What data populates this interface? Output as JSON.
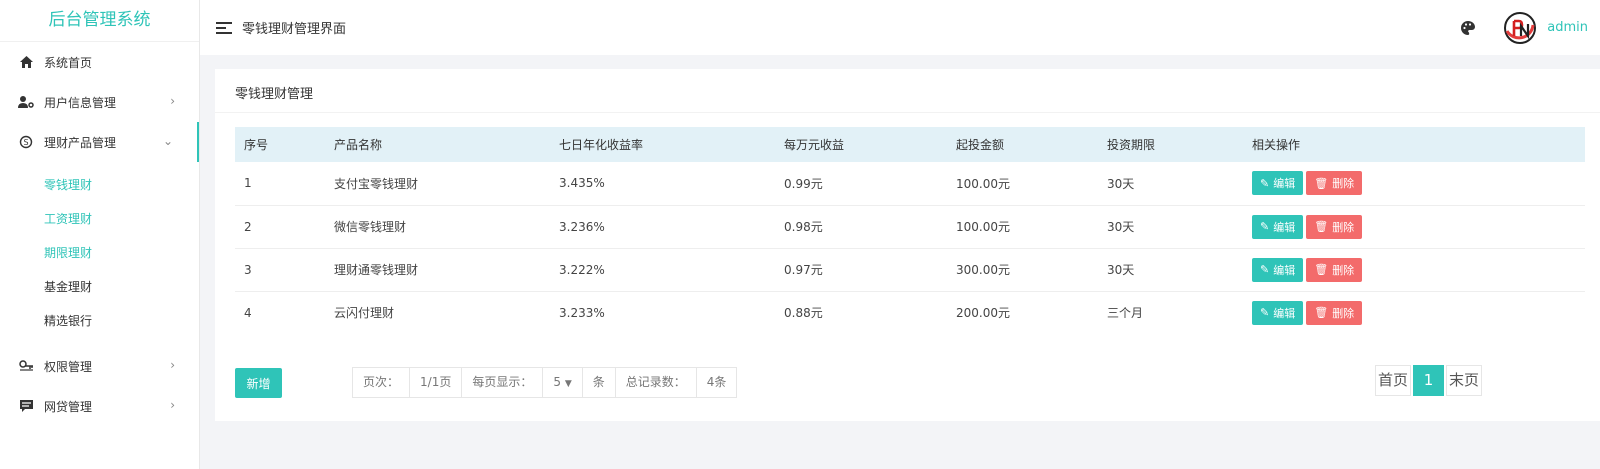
{
  "brand": "后台管理系统",
  "sidebar": {
    "items": [
      {
        "label": "系统首页",
        "icon": "home-icon"
      },
      {
        "label": "用户信息管理",
        "icon": "user-gear-icon",
        "arrow": "›"
      },
      {
        "label": "理财产品管理",
        "icon": "product-icon",
        "arrow": "⌄"
      },
      {
        "label": "权限管理",
        "icon": "key-icon",
        "arrow": "›"
      },
      {
        "label": "网贷管理",
        "icon": "chat-icon",
        "arrow": "›"
      }
    ],
    "submenu": [
      {
        "label": "零钱理财"
      },
      {
        "label": "工资理财"
      },
      {
        "label": "期限理财"
      },
      {
        "label": "基金理财"
      },
      {
        "label": "精选银行"
      }
    ]
  },
  "header": {
    "title": "零钱理财管理界面",
    "username": "admin"
  },
  "card": {
    "title": "零钱理财管理",
    "columns": [
      "序号",
      "产品名称",
      "七日年化收益率",
      "每万元收益",
      "起投金额",
      "投资期限",
      "相关操作"
    ],
    "rows": [
      {
        "id": "1",
        "name": "支付宝零钱理财",
        "rate": "3.435%",
        "income": "0.99元",
        "min": "100.00元",
        "term": "30天"
      },
      {
        "id": "2",
        "name": "微信零钱理财",
        "rate": "3.236%",
        "income": "0.98元",
        "min": "100.00元",
        "term": "30天"
      },
      {
        "id": "3",
        "name": "理财通零钱理财",
        "rate": "3.222%",
        "income": "0.97元",
        "min": "300.00元",
        "term": "30天"
      },
      {
        "id": "4",
        "name": "云闪付理财",
        "rate": "3.233%",
        "income": "0.88元",
        "min": "200.00元",
        "term": "三个月"
      }
    ],
    "edit_label": "编辑",
    "delete_label": "删除",
    "add_label": "新增"
  },
  "pagination": {
    "page_label": "页次：",
    "page_value": "1/1页",
    "per_page_label": "每页显示：",
    "per_page_value": "5",
    "per_page_unit": "条",
    "total_label": "总记录数：",
    "total_value": "4条",
    "first_label": "首页",
    "current_page": "1",
    "last_label": "末页"
  },
  "colors": {
    "accent": "#2fc4b8",
    "danger": "#f36b6b",
    "table_header": "#e2f1f7"
  }
}
